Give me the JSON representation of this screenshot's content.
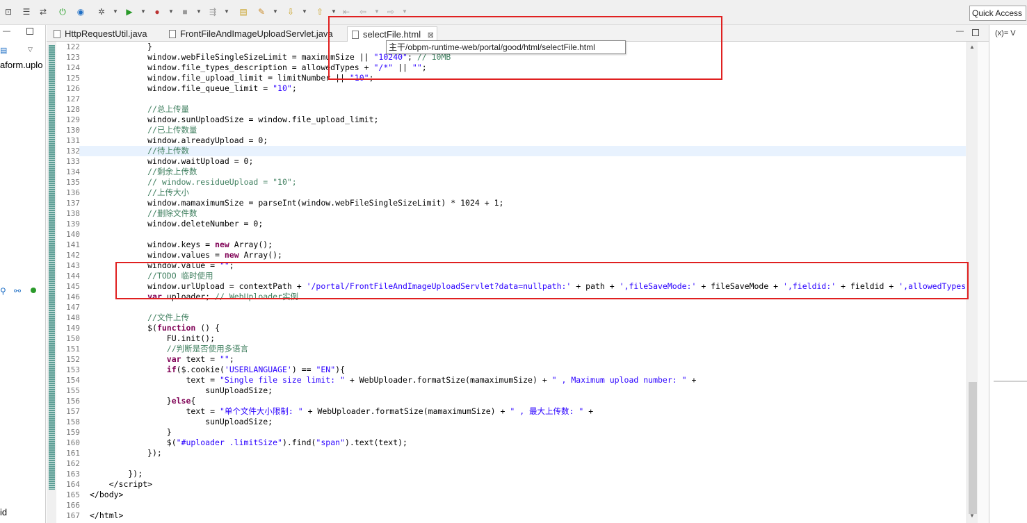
{
  "toolbar": {
    "quick_access": "Quick Access"
  },
  "left_panel": {
    "file_text": "aform.uplo",
    "bottom_text": "id"
  },
  "tabs": [
    {
      "label": "HttpRequestUtil.java"
    },
    {
      "label": "FrontFileAndImageUploadServlet.java"
    },
    {
      "label": "selectFile.html",
      "close": "⊠"
    }
  ],
  "tooltip": "主干/obpm-runtime-web/portal/good/html/selectFile.html",
  "right_panel": {
    "label": "(x)= V"
  },
  "code_lines": [
    {
      "n": "122",
      "html": "            }"
    },
    {
      "n": "123",
      "html": "            window.webFileSingleSizeLimit = maximumSize || <span class=\"s\">\"10240\"</span>; <span class=\"c\">// 10MB</span>"
    },
    {
      "n": "124",
      "html": "            window.file_types_description = allowedTypes + <span class=\"s\">\"/*\"</span> || <span class=\"s\">\"\"</span>;"
    },
    {
      "n": "125",
      "html": "            window.file_upload_limit = limitNumber || <span class=\"s\">\"10\"</span>;"
    },
    {
      "n": "126",
      "html": "            window.file_queue_limit = <span class=\"s\">\"10\"</span>;"
    },
    {
      "n": "127",
      "html": ""
    },
    {
      "n": "128",
      "html": "            <span class=\"c\">//总上传量</span>"
    },
    {
      "n": "129",
      "html": "            window.sunUploadSize = window.file_upload_limit;"
    },
    {
      "n": "130",
      "html": "            <span class=\"c\">//已上传数量</span>"
    },
    {
      "n": "131",
      "html": "            window.alreadyUpload = 0;"
    },
    {
      "n": "132",
      "html": "            <span class=\"c\">//待上传数</span>"
    },
    {
      "n": "133",
      "html": "            window.waitUpload = 0;"
    },
    {
      "n": "134",
      "html": "            <span class=\"c\">//剩余上传数</span>"
    },
    {
      "n": "135",
      "html": "            <span class=\"c\">// window.residueUpload = \"10\";</span>"
    },
    {
      "n": "136",
      "html": "            <span class=\"c\">//上传大小</span>"
    },
    {
      "n": "137",
      "html": "            window.mamaximumSize = parseInt(window.webFileSingleSizeLimit) * 1024 + 1;"
    },
    {
      "n": "138",
      "html": "            <span class=\"c\">//删除文件数</span>"
    },
    {
      "n": "139",
      "html": "            window.deleteNumber = 0;"
    },
    {
      "n": "140",
      "html": ""
    },
    {
      "n": "141",
      "html": "            window.keys = <span class=\"k\">new</span> Array();"
    },
    {
      "n": "142",
      "html": "            window.values = <span class=\"k\">new</span> Array();"
    },
    {
      "n": "143",
      "html": "            window.value = <span class=\"s\">\"\"</span>;"
    },
    {
      "n": "144",
      "html": "            <span class=\"c\">//TODO 临时使用</span>"
    },
    {
      "n": "145",
      "html": "            window.urlUpload = contextPath + <span class=\"s\">'/portal/FrontFileAndImageUploadServlet?data=nullpath:'</span> + path + <span class=\"s\">',fileSaveMode:'</span> + fileSaveMode + <span class=\"s\">',fieldid:'</span> + fieldid + <span class=\"s\">',allowedTypes</span>"
    },
    {
      "n": "146",
      "html": "            <span class=\"k\">var</span> uploader; <span class=\"c\">// WebUploader实例</span>"
    },
    {
      "n": "147",
      "html": ""
    },
    {
      "n": "148",
      "html": "            <span class=\"c\">//文件上传</span>"
    },
    {
      "n": "149",
      "html": "            $(<span class=\"k\">function</span> () {"
    },
    {
      "n": "150",
      "html": "                FU.init();"
    },
    {
      "n": "151",
      "html": "                <span class=\"c\">//判断是否使用多语言</span>"
    },
    {
      "n": "152",
      "html": "                <span class=\"k\">var</span> text = <span class=\"s\">\"\"</span>;"
    },
    {
      "n": "153",
      "html": "                <span class=\"k\">if</span>($.cookie(<span class=\"s\">'USERLANGUAGE'</span>) == <span class=\"s\">\"EN\"</span>){"
    },
    {
      "n": "154",
      "html": "                    text = <span class=\"s\">\"Single file size limit: \"</span> + WebUploader.formatSize(mamaximumSize) + <span class=\"s\">\" , Maximum upload number: \"</span> +"
    },
    {
      "n": "155",
      "html": "                        sunUploadSize;"
    },
    {
      "n": "156",
      "html": "                }<span class=\"k\">else</span>{"
    },
    {
      "n": "157",
      "html": "                    text = <span class=\"s\">\"单个文件大小限制: \"</span> + WebUploader.formatSize(mamaximumSize) + <span class=\"s\">\" , 最大上传数: \"</span> +"
    },
    {
      "n": "158",
      "html": "                        sunUploadSize;"
    },
    {
      "n": "159",
      "html": "                }"
    },
    {
      "n": "160",
      "html": "                $(<span class=\"s\">\"#uploader .limitSize\"</span>).find(<span class=\"s\">\"span\"</span>).text(text);"
    },
    {
      "n": "161",
      "html": "            });"
    },
    {
      "n": "162",
      "html": ""
    },
    {
      "n": "163",
      "html": "        });"
    },
    {
      "n": "164",
      "html": "    &lt;/script&gt;"
    },
    {
      "n": "165",
      "html": "&lt;/body&gt;"
    },
    {
      "n": "166",
      "html": ""
    },
    {
      "n": "167",
      "html": "&lt;/html&gt;"
    }
  ],
  "current_line": "132"
}
